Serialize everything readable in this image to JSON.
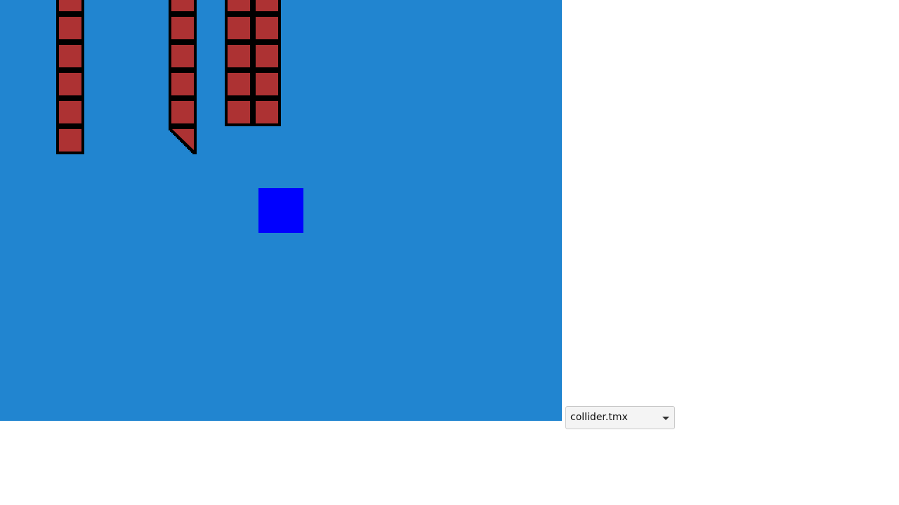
{
  "game": {
    "background_color": "#2185d0",
    "tile_fill_color": "#ad3233",
    "tile_border_color": "#000000",
    "player_color": "#0000ff"
  },
  "map_selector": {
    "selected": "collider.tmx",
    "icon": "chevron-down-icon"
  }
}
